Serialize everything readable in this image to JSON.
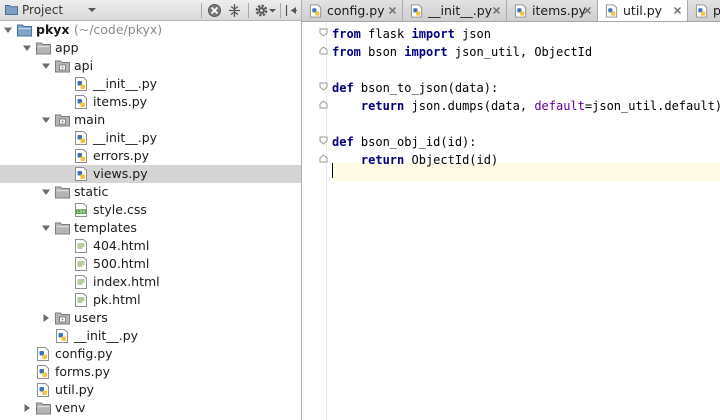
{
  "panel": {
    "title": "Project",
    "icons": [
      "project-folder-icon",
      "dropdown-arrow-icon",
      "locate-icon",
      "collapse-all-icon",
      "gear-icon",
      "hide-panel-icon"
    ]
  },
  "tree": {
    "root": {
      "name": "pkyx",
      "path": "(~/code/pkyx)"
    },
    "items": [
      {
        "label": "app"
      },
      {
        "label": "api"
      },
      {
        "label": "__init__.py"
      },
      {
        "label": "items.py"
      },
      {
        "label": "main"
      },
      {
        "label": "__init__.py"
      },
      {
        "label": "errors.py"
      },
      {
        "label": "views.py"
      },
      {
        "label": "static"
      },
      {
        "label": "style.css"
      },
      {
        "label": "templates"
      },
      {
        "label": "404.html"
      },
      {
        "label": "500.html"
      },
      {
        "label": "index.html"
      },
      {
        "label": "pk.html"
      },
      {
        "label": "users"
      },
      {
        "label": "__init__.py"
      },
      {
        "label": "config.py"
      },
      {
        "label": "forms.py"
      },
      {
        "label": "util.py"
      },
      {
        "label": "venv"
      }
    ],
    "selected": "views.py"
  },
  "tabs": [
    {
      "label": "config.py"
    },
    {
      "label": "__init__.py"
    },
    {
      "label": "items.py"
    },
    {
      "label": "util.py",
      "active": true
    },
    {
      "label": "pk"
    }
  ],
  "code": {
    "lines": [
      [
        {
          "t": "from",
          "c": "kw"
        },
        {
          "t": " flask "
        },
        {
          "t": "import",
          "c": "kw"
        },
        {
          "t": " json"
        }
      ],
      [
        {
          "t": "from",
          "c": "kw"
        },
        {
          "t": " bson "
        },
        {
          "t": "import",
          "c": "kw"
        },
        {
          "t": " json_util, ObjectId"
        }
      ],
      [],
      [
        {
          "t": "def",
          "c": "kw"
        },
        {
          "t": " bson_to_json(data):"
        }
      ],
      [
        {
          "t": "    "
        },
        {
          "t": "return",
          "c": "kw"
        },
        {
          "t": " json.dumps(data, "
        },
        {
          "t": "default",
          "c": "kwarg"
        },
        {
          "t": "=json_util.default)"
        }
      ],
      [],
      [
        {
          "t": "def",
          "c": "kw"
        },
        {
          "t": " bson_obj_id(id):"
        }
      ],
      [
        {
          "t": "    "
        },
        {
          "t": "return",
          "c": "kw"
        },
        {
          "t": " ObjectId(id)"
        }
      ],
      []
    ]
  },
  "colors": {
    "keyword": "#000080",
    "kwarg": "#660099",
    "selection": "#d5d5d5",
    "caret_line": "#fffae3"
  }
}
